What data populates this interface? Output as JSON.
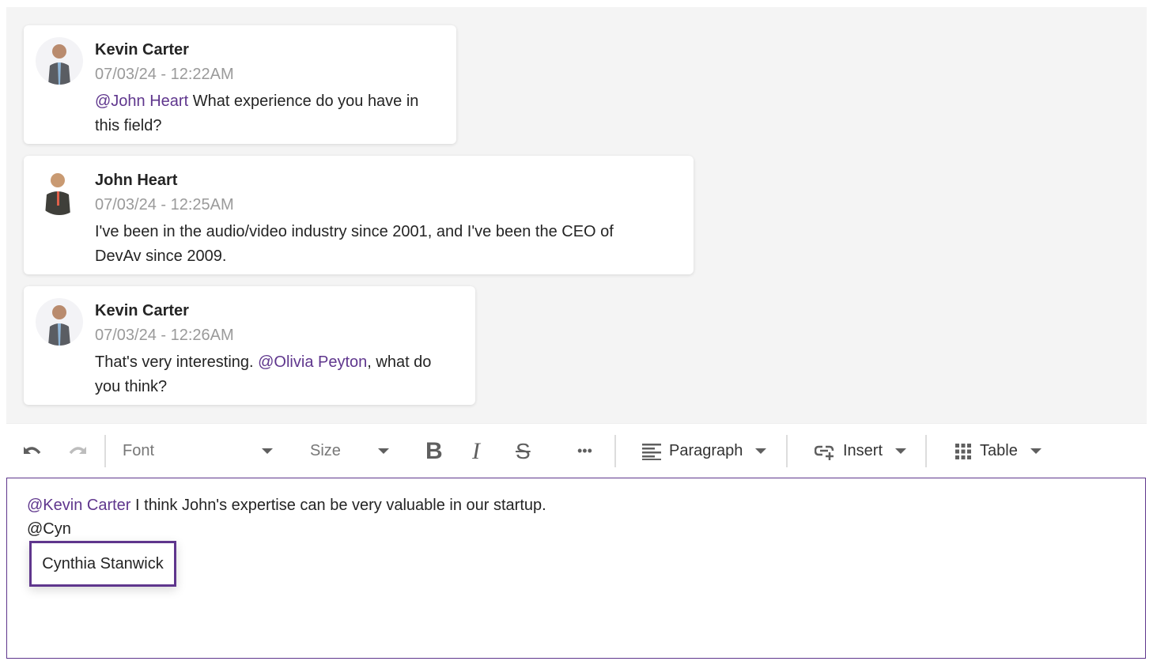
{
  "messages": [
    {
      "author": "Kevin Carter",
      "timestamp": "07/03/24 - 12:22AM",
      "mention": "@John Heart",
      "text_after": " What experience do you have in this field?",
      "text_before": ""
    },
    {
      "author": "John Heart",
      "timestamp": "07/03/24 - 12:25AM",
      "mention": "",
      "text_before": "I've been in the audio/video industry since 2001, and I've been the CEO of DevAv since 2009.",
      "text_after": ""
    },
    {
      "author": "Kevin Carter",
      "timestamp": "07/03/24 - 12:26AM",
      "text_before": "That's very interesting. ",
      "mention": "@Olivia Peyton",
      "text_after": ", what do you think?"
    }
  ],
  "toolbar": {
    "font_label": "Font",
    "size_label": "Size",
    "paragraph_label": "Paragraph",
    "insert_label": "Insert",
    "table_label": "Table",
    "more_label": "•••"
  },
  "editor": {
    "line1_mention": "@Kevin Carter",
    "line1_text": " I think John's expertise can be very valuable in our startup.",
    "line2_text": "@Cyn",
    "suggestion": "Cynthia Stanwick"
  },
  "colors": {
    "accent": "#5f368d",
    "background": "#f4f4f4"
  }
}
